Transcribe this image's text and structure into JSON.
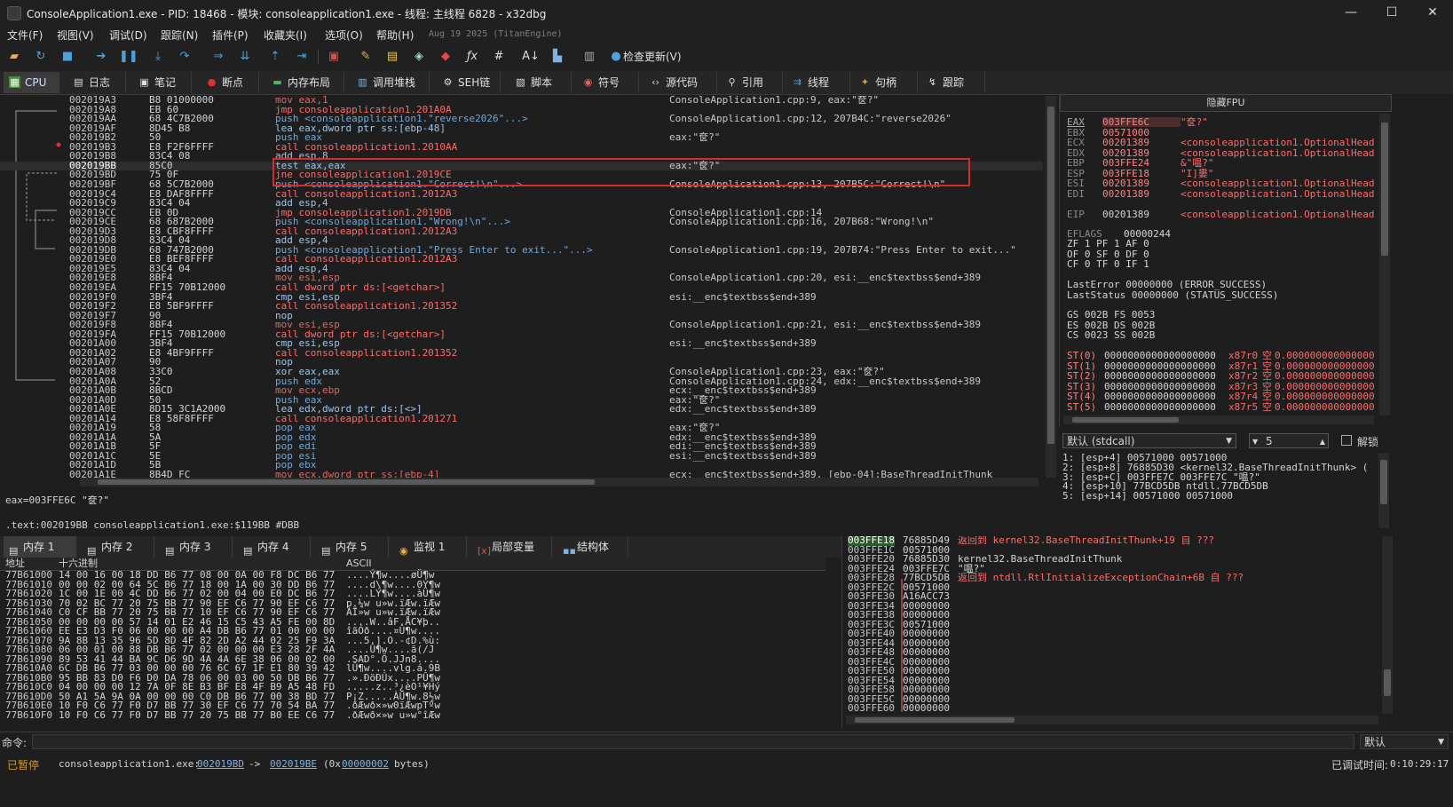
{
  "window": {
    "title": "ConsoleApplication1.exe - PID: 18468 - 模块: consoleapplication1.exe - 线程: 主线程 6828 - x32dbg",
    "minimize": "—",
    "maximize": "☐",
    "close": "✕"
  },
  "menu": {
    "items": [
      "文件(F)",
      "视图(V)",
      "调试(D)",
      "跟踪(N)",
      "插件(P)",
      "收藏夹(I)",
      "选项(O)",
      "帮助(H)"
    ],
    "build": "Aug 19 2025 (TitanEngine)"
  },
  "toolbar": {
    "update_label": "检查更新(V)"
  },
  "tabs": [
    {
      "label": "CPU",
      "icon": "cpu-icon"
    },
    {
      "label": "日志",
      "icon": "log-icon"
    },
    {
      "label": "笔记",
      "icon": "notes-icon"
    },
    {
      "label": "断点",
      "icon": "breakpoint-icon"
    },
    {
      "label": "内存布局",
      "icon": "memory-map-icon"
    },
    {
      "label": "调用堆栈",
      "icon": "callstack-icon"
    },
    {
      "label": "SEH链",
      "icon": "seh-icon"
    },
    {
      "label": "脚本",
      "icon": "script-icon"
    },
    {
      "label": "符号",
      "icon": "symbols-icon"
    },
    {
      "label": "源代码",
      "icon": "source-icon"
    },
    {
      "label": "引用",
      "icon": "references-icon"
    },
    {
      "label": "线程",
      "icon": "threads-icon"
    },
    {
      "label": "句柄",
      "icon": "handles-icon"
    },
    {
      "label": "跟踪",
      "icon": "trace-icon"
    }
  ],
  "disasm": [
    {
      "addr": "002019A3",
      "bytes": "B8 01000000",
      "asm": "mov eax,1",
      "k": "mov",
      "cmt": "ConsoleApplication1.cpp:9, eax:\"奁?\""
    },
    {
      "addr": "002019A8",
      "bytes": "EB 60",
      "asm": "jmp consoleapplication1.201A0A",
      "k": "jmp",
      "cmt": ""
    },
    {
      "addr": "002019AA",
      "bytes": "68 4C7B2000",
      "asm": "push <consoleapplication1.\"reverse2026\"...>",
      "k": "push",
      "cmt": "ConsoleApplication1.cpp:12, 207B4C:\"reverse2026\""
    },
    {
      "addr": "002019AF",
      "bytes": "8D45 B8",
      "asm": "lea eax,dword ptr ss:[ebp-48]",
      "k": "plain",
      "cmt": ""
    },
    {
      "addr": "002019B2",
      "bytes": "50",
      "asm": "push eax",
      "k": "push",
      "cmt": "eax:\"奁?\""
    },
    {
      "addr": "002019B3",
      "bytes": "E8 F2F6FFFF",
      "asm": "call consoleapplication1.2010AA",
      "k": "call",
      "cmt": ""
    },
    {
      "addr": "002019B8",
      "bytes": "83C4 08",
      "asm": "add esp,8",
      "k": "plain",
      "cmt": ""
    },
    {
      "addr": "002019BB",
      "bytes": "85C0",
      "asm": "test eax,eax",
      "k": "plain",
      "cmt": "eax:\"奁?\"",
      "sel": true
    },
    {
      "addr": "002019BD",
      "bytes": "75 0F",
      "asm": "jne consoleapplication1.2019CE",
      "k": "jmp",
      "cmt": ""
    },
    {
      "addr": "002019BF",
      "bytes": "68 5C7B2000",
      "asm": "push <consoleapplication1.\"Correct!\\n\"...>",
      "k": "push",
      "cmt": "ConsoleApplication1.cpp:13, 207B5C:\"Correct!\\n\""
    },
    {
      "addr": "002019C4",
      "bytes": "E8 DAF8FFFF",
      "asm": "call consoleapplication1.2012A3",
      "k": "call",
      "cmt": ""
    },
    {
      "addr": "002019C9",
      "bytes": "83C4 04",
      "asm": "add esp,4",
      "k": "plain",
      "cmt": ""
    },
    {
      "addr": "002019CC",
      "bytes": "EB 0D",
      "asm": "jmp consoleapplication1.2019DB",
      "k": "jmp",
      "cmt": "ConsoleApplication1.cpp:14"
    },
    {
      "addr": "002019CE",
      "bytes": "68 687B2000",
      "asm": "push <consoleapplication1.\"Wrong!\\n\"...>",
      "k": "push",
      "cmt": "ConsoleApplication1.cpp:16, 207B68:\"Wrong!\\n\""
    },
    {
      "addr": "002019D3",
      "bytes": "E8 CBF8FFFF",
      "asm": "call consoleapplication1.2012A3",
      "k": "call",
      "cmt": ""
    },
    {
      "addr": "002019D8",
      "bytes": "83C4 04",
      "asm": "add esp,4",
      "k": "plain",
      "cmt": ""
    },
    {
      "addr": "002019DB",
      "bytes": "68 747B2000",
      "asm": "push <consoleapplication1.\"Press Enter to exit...\"...>",
      "k": "push",
      "cmt": "ConsoleApplication1.cpp:19, 207B74:\"Press Enter to exit...\""
    },
    {
      "addr": "002019E0",
      "bytes": "E8 BEF8FFFF",
      "asm": "call consoleapplication1.2012A3",
      "k": "call",
      "cmt": ""
    },
    {
      "addr": "002019E5",
      "bytes": "83C4 04",
      "asm": "add esp,4",
      "k": "plain",
      "cmt": ""
    },
    {
      "addr": "002019E8",
      "bytes": "8BF4",
      "asm": "mov esi,esp",
      "k": "mov",
      "cmt": "ConsoleApplication1.cpp:20, esi:__enc$textbss$end+389"
    },
    {
      "addr": "002019EA",
      "bytes": "FF15 70B12000",
      "asm": "call dword ptr ds:[<getchar>]",
      "k": "call",
      "cmt": ""
    },
    {
      "addr": "002019F0",
      "bytes": "3BF4",
      "asm": "cmp esi,esp",
      "k": "plain",
      "cmt": "esi:__enc$textbss$end+389"
    },
    {
      "addr": "002019F2",
      "bytes": "E8 5BF9FFFF",
      "asm": "call consoleapplication1.201352",
      "k": "call",
      "cmt": ""
    },
    {
      "addr": "002019F7",
      "bytes": "90",
      "asm": "nop",
      "k": "plain",
      "cmt": ""
    },
    {
      "addr": "002019F8",
      "bytes": "8BF4",
      "asm": "mov esi,esp",
      "k": "mov",
      "cmt": "ConsoleApplication1.cpp:21, esi:__enc$textbss$end+389"
    },
    {
      "addr": "002019FA",
      "bytes": "FF15 70B12000",
      "asm": "call dword ptr ds:[<getchar>]",
      "k": "call",
      "cmt": ""
    },
    {
      "addr": "00201A00",
      "bytes": "3BF4",
      "asm": "cmp esi,esp",
      "k": "plain",
      "cmt": "esi:__enc$textbss$end+389"
    },
    {
      "addr": "00201A02",
      "bytes": "E8 4BF9FFFF",
      "asm": "call consoleapplication1.201352",
      "k": "call",
      "cmt": ""
    },
    {
      "addr": "00201A07",
      "bytes": "90",
      "asm": "nop",
      "k": "plain",
      "cmt": ""
    },
    {
      "addr": "00201A08",
      "bytes": "33C0",
      "asm": "xor eax,eax",
      "k": "plain",
      "cmt": "ConsoleApplication1.cpp:23, eax:\"奁?\""
    },
    {
      "addr": "00201A0A",
      "bytes": "52",
      "asm": "push edx",
      "k": "push",
      "cmt": "ConsoleApplication1.cpp:24, edx:__enc$textbss$end+389"
    },
    {
      "addr": "00201A0B",
      "bytes": "8BCD",
      "asm": "mov ecx,ebp",
      "k": "mov",
      "cmt": "ecx:__enc$textbss$end+389"
    },
    {
      "addr": "00201A0D",
      "bytes": "50",
      "asm": "push eax",
      "k": "push",
      "cmt": "eax:\"奁?\""
    },
    {
      "addr": "00201A0E",
      "bytes": "8D15 3C1A2000",
      "asm": "lea edx,dword ptr ds:[<>]",
      "k": "plain",
      "cmt": "edx:__enc$textbss$end+389"
    },
    {
      "addr": "00201A14",
      "bytes": "E8 58F8FFFF",
      "asm": "call consoleapplication1.201271",
      "k": "call",
      "cmt": ""
    },
    {
      "addr": "00201A19",
      "bytes": "58",
      "asm": "pop eax",
      "k": "push",
      "cmt": "eax:\"奁?\""
    },
    {
      "addr": "00201A1A",
      "bytes": "5A",
      "asm": "pop edx",
      "k": "push",
      "cmt": "edx:__enc$textbss$end+389"
    },
    {
      "addr": "00201A1B",
      "bytes": "5F",
      "asm": "pop edi",
      "k": "push",
      "cmt": "edi:__enc$textbss$end+389"
    },
    {
      "addr": "00201A1C",
      "bytes": "5E",
      "asm": "pop esi",
      "k": "push",
      "cmt": "esi:__enc$textbss$end+389"
    },
    {
      "addr": "00201A1D",
      "bytes": "5B",
      "asm": "pop ebx",
      "k": "push",
      "cmt": ""
    },
    {
      "addr": "00201A1E",
      "bytes": "8B4D FC",
      "asm": "mov ecx,dword ptr ss:[ebp-4]",
      "k": "mov",
      "cmt": "ecx:__enc$textbss$end+389, [ebp-04]:BaseThreadInitThunk"
    }
  ],
  "info": {
    "line1": "eax=003FFE6C \"奁?\"",
    "line2": ".text:002019BB consoleapplication1.exe:$119BB #DBB"
  },
  "regs": {
    "header": "隐藏FPU",
    "gp": [
      {
        "n": "EAX",
        "v": "003FFE6C",
        "c": "\"奁?\""
      },
      {
        "n": "EBX",
        "v": "00571000",
        "c": ""
      },
      {
        "n": "ECX",
        "v": "00201389",
        "c": "<consoleapplication1.OptionalHead"
      },
      {
        "n": "EDX",
        "v": "00201389",
        "c": "<consoleapplication1.OptionalHead"
      },
      {
        "n": "EBP",
        "v": "003FFE24",
        "c": "&\"嗢?\""
      },
      {
        "n": "ESP",
        "v": "003FFE18",
        "c": "\"I]婁\""
      },
      {
        "n": "ESI",
        "v": "00201389",
        "c": "<consoleapplication1.OptionalHead"
      },
      {
        "n": "EDI",
        "v": "00201389",
        "c": "<consoleapplication1.OptionalHead"
      }
    ],
    "eip": {
      "n": "EIP",
      "v": "00201389",
      "c": "<consoleapplication1.OptionalHead"
    },
    "eflags": {
      "n": "EFLAGS",
      "v": "00000244"
    },
    "flags": [
      "ZF 1  PF 1  AF 0",
      "OF 0  SF 0  DF 0",
      "CF 0  TF 0  IF 1"
    ],
    "last": [
      "LastError  00000000 (ERROR_SUCCESS)",
      "LastStatus 00000000 (STATUS_SUCCESS)"
    ],
    "seg": [
      "GS 002B  FS 0053",
      "ES 002B  DS 002B",
      "CS 0023  SS 002B"
    ],
    "fpu": [
      {
        "n": "ST(0)",
        "v": "0000000000000000000",
        "t": "x87r0",
        "e": "空",
        "f": "0.000000000000000"
      },
      {
        "n": "ST(1)",
        "v": "0000000000000000000",
        "t": "x87r1",
        "e": "空",
        "f": "0.000000000000000"
      },
      {
        "n": "ST(2)",
        "v": "0000000000000000000",
        "t": "x87r2",
        "e": "空",
        "f": "0.000000000000000"
      },
      {
        "n": "ST(3)",
        "v": "0000000000000000000",
        "t": "x87r3",
        "e": "空",
        "f": "0.000000000000000"
      },
      {
        "n": "ST(4)",
        "v": "0000000000000000000",
        "t": "x87r4",
        "e": "空",
        "f": "0.000000000000000"
      },
      {
        "n": "ST(5)",
        "v": "0000000000000000000",
        "t": "x87r5",
        "e": "空",
        "f": "0.000000000000000"
      }
    ]
  },
  "callconv": {
    "value": "默认 (stdcall)",
    "argc": "5",
    "unlock": "解锁"
  },
  "args": [
    "1: [esp+4] 00571000 00571000",
    "2: [esp+8] 76885D30 <kernel32.BaseThreadInitThunk> (",
    "3: [esp+C] 003FFE7C 003FFE7C \"嗢?\"",
    "4: [esp+10] 77BCD5DB ntdll.77BCD5DB",
    "5: [esp+14] 00571000 00571000"
  ],
  "memtabs": [
    {
      "label": "内存 1",
      "icon": "memory-icon"
    },
    {
      "label": "内存 2",
      "icon": "memory-icon"
    },
    {
      "label": "内存 3",
      "icon": "memory-icon"
    },
    {
      "label": "内存 4",
      "icon": "memory-icon"
    },
    {
      "label": "内存 5",
      "icon": "memory-icon"
    },
    {
      "label": "监视 1",
      "icon": "watch-icon"
    },
    {
      "label": "局部变量",
      "icon": "locals-icon"
    },
    {
      "label": "结构体",
      "icon": "struct-icon"
    }
  ],
  "hex_headers": {
    "addr": "地址",
    "hex": "十六进制",
    "ascii": "ASCII"
  },
  "hex": [
    {
      "a": "77B61000",
      "h": "14 00 16 00 18 DD B6 77 08 00 0A 00 F8 DC B6 77",
      "t": "....Ý¶w....øÜ¶w"
    },
    {
      "a": "77B61010",
      "h": "00 00 02 00 64 5C B6 77 18 00 1A 00 30 DD B6 77",
      "t": "....d\\¶w....0Ý¶w"
    },
    {
      "a": "77B61020",
      "h": "1C 00 1E 00 4C DD B6 77 02 00 04 00 E0 DC B6 77",
      "t": "....LÝ¶w....àÜ¶w"
    },
    {
      "a": "77B61030",
      "h": "70 02 BC 77 20 75 BB 77 90 EF C6 77 90 EF C6 77",
      "t": "p.¼w u»w.ïÆw.ïÆw"
    },
    {
      "a": "77B61040",
      "h": "C0 CF BB 77 20 75 BB 77 10 EF C6 77 90 EF C6 77",
      "t": "ÀÏ»w u»w.ïÆw.ïÆw"
    },
    {
      "a": "77B61050",
      "h": "00 00 00 00 57 14 01 E2 46 15 C5 43 A5 FE 00 8D",
      "t": "....W..âF.ÅC¥þ.."
    },
    {
      "a": "77B61060",
      "h": "EE E3 D3 F0 06 00 00 00 A4 DB B6 77 01 00 00 00",
      "t": "îãÓð....¤Û¶w...."
    },
    {
      "a": "77B61070",
      "h": "9A 8B 13 35 96 5D 8D 4F 82 2D A2 44 02 25 F9 3A",
      "t": "...5.].O.-¢D.%ù:"
    },
    {
      "a": "77B61080",
      "h": "06 00 01 00 88 DB B6 77 02 00 00 00 E3 28 2F 4A",
      "t": "....Û¶w....ã(/J"
    },
    {
      "a": "77B61090",
      "h": "89 53 41 44 BA 9C D6 9D 4A 4A 6E 38 06 00 02 00",
      "t": ".SAD°.Ö.JJn8...."
    },
    {
      "a": "77B610A0",
      "h": "6C DB B6 77 03 00 00 00 76 6C 67 1F E1 80 39 42",
      "t": "lÛ¶w....vlg.á.9B"
    },
    {
      "a": "77B610B0",
      "h": "95 BB 83 D0 F6 D0 DA 78 06 00 03 00 50 DB B6 77",
      "t": ".».ÐöÐÚx....PÛ¶w"
    },
    {
      "a": "77B610C0",
      "h": "04 00 00 00 12 7A 0F 8E B3 BF E8 4F B9 A5 48 FD",
      "t": ".....z..³¿èO¹¥Hý"
    },
    {
      "a": "77B610D0",
      "h": "50 A1 5A 9A 0A 00 00 00 C0 DB B6 77 00 38 BD 77",
      "t": "P¡Z.....ÀÛ¶w.8½w"
    },
    {
      "a": "77B610E0",
      "h": "10 F0 C6 77 F0 D7 BB 77 30 EF C6 77 70 54 BA 77",
      "t": ".ðÆwð×»w0ïÆwpTºw"
    },
    {
      "a": "77B610F0",
      "h": "10 F0 C6 77 F0 D7 BB 77 20 75 BB 77 B0 EE C6 77",
      "t": ".ðÆwð×»w u»w°îÆw"
    }
  ],
  "stack": [
    {
      "a": "003FFE18",
      "v": "76885D49",
      "c": "返回到 kernel32.BaseThreadInitThunk+19 自 ???",
      "top": true
    },
    {
      "a": "003FFE1C",
      "v": "00571000",
      "c": ""
    },
    {
      "a": "003FFE20",
      "v": "76885D30",
      "c": "kernel32.BaseThreadInitThunk"
    },
    {
      "a": "003FFE24",
      "v": "003FFE7C",
      "c": "\"嗢?\""
    },
    {
      "a": "003FFE28",
      "v": "77BCD5DB",
      "c": "返回到 ntdll.RtlInitializeExceptionChain+6B 自 ???"
    },
    {
      "a": "003FFE2C",
      "v": "00571000",
      "c": ""
    },
    {
      "a": "003FFE30",
      "v": "A16ACC73",
      "c": ""
    },
    {
      "a": "003FFE34",
      "v": "00000000",
      "c": ""
    },
    {
      "a": "003FFE38",
      "v": "00000000",
      "c": ""
    },
    {
      "a": "003FFE3C",
      "v": "00571000",
      "c": ""
    },
    {
      "a": "003FFE40",
      "v": "00000000",
      "c": ""
    },
    {
      "a": "003FFE44",
      "v": "00000000",
      "c": ""
    },
    {
      "a": "003FFE48",
      "v": "00000000",
      "c": ""
    },
    {
      "a": "003FFE4C",
      "v": "00000000",
      "c": ""
    },
    {
      "a": "003FFE50",
      "v": "00000000",
      "c": ""
    },
    {
      "a": "003FFE54",
      "v": "00000000",
      "c": ""
    },
    {
      "a": "003FFE58",
      "v": "00000000",
      "c": ""
    },
    {
      "a": "003FFE5C",
      "v": "00000000",
      "c": ""
    },
    {
      "a": "003FFE60",
      "v": "00000000",
      "c": ""
    }
  ],
  "command": {
    "label": "命令:",
    "mode": "默认"
  },
  "status": {
    "state": "已暂停",
    "module": "consoleapplication1.exe:",
    "from": "002019BD",
    "arrow": "->",
    "to": "002019BE",
    "size_prefix": "(0x",
    "size": "00000002",
    "size_suffix": "bytes)",
    "time_label": "已调试时间:",
    "time": "0:10:29:17"
  },
  "colors": {
    "accent": "#cfe0ff",
    "highlight_box": "#e02020",
    "paused": "#d49a2a"
  }
}
